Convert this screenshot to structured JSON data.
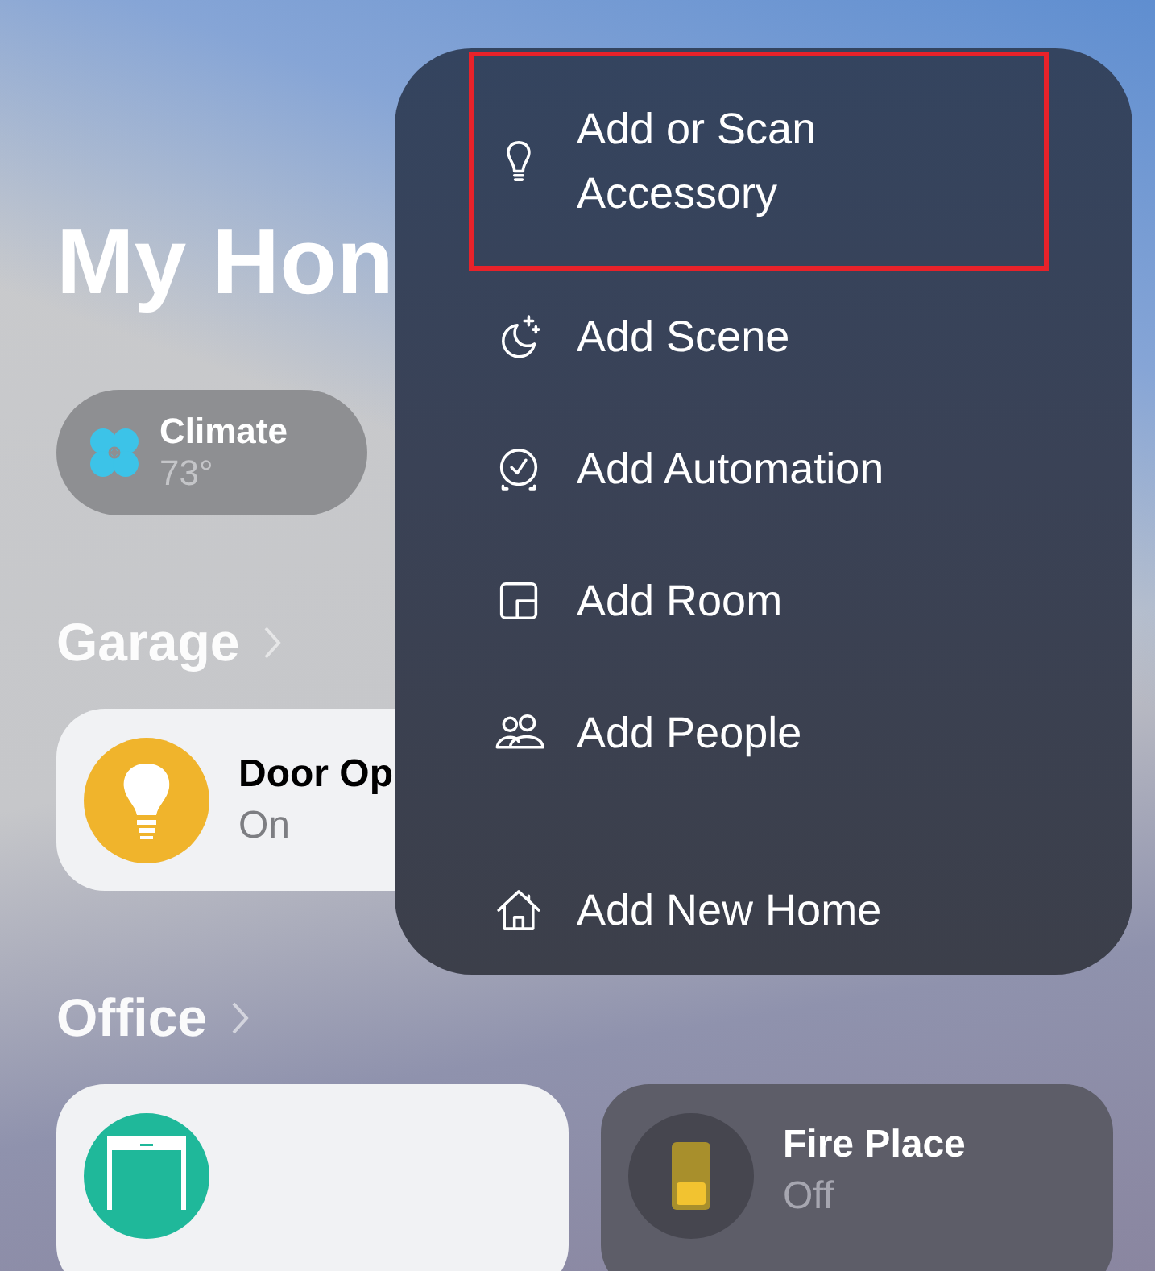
{
  "home_title": "My Hon",
  "status_tiles": [
    {
      "kind": "climate",
      "label": "Climate",
      "value": "73°"
    }
  ],
  "sections": [
    {
      "title": "Garage",
      "accessories": [
        {
          "kind": "light",
          "name": "Door Op",
          "status": "On",
          "on": true
        }
      ]
    },
    {
      "title": "Office",
      "accessories": [
        {
          "kind": "door",
          "on": true
        },
        {
          "kind": "switch",
          "name": "Fire Place",
          "status": "Off",
          "on": false
        }
      ]
    }
  ],
  "menu": {
    "groups": [
      [
        {
          "kind": "accessory",
          "label": "Add or Scan Accessory",
          "highlighted": true
        },
        {
          "kind": "scene",
          "label": "Add Scene",
          "highlighted": false
        },
        {
          "kind": "automation",
          "label": "Add Automation",
          "highlighted": false
        },
        {
          "kind": "room",
          "label": "Add Room",
          "highlighted": false
        },
        {
          "kind": "people",
          "label": "Add People",
          "highlighted": false
        }
      ],
      [
        {
          "kind": "home",
          "label": "Add New Home",
          "highlighted": false
        }
      ]
    ]
  }
}
